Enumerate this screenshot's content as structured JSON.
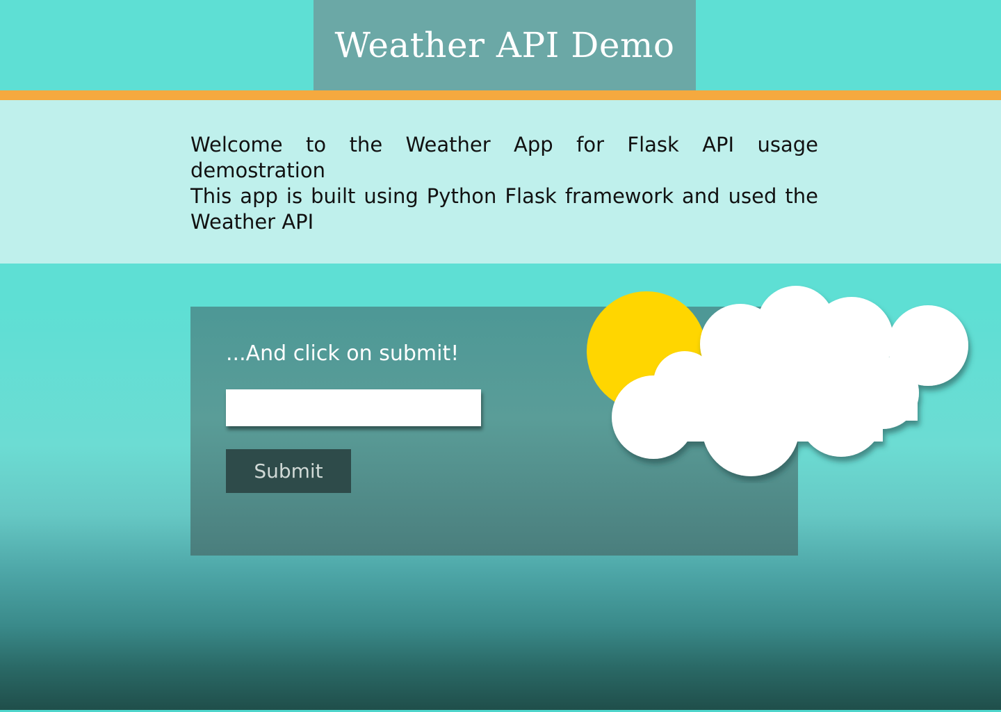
{
  "header": {
    "title": "Weather API Demo"
  },
  "intro": {
    "line1": "Welcome to the Weather App for Flask API usage demostration",
    "line2": "This app is built using Python Flask framework and used the Weather API"
  },
  "form": {
    "prompt": "...And click on submit!",
    "city_value": "",
    "submit_label": "Submit"
  },
  "colors": {
    "accent_orange": "#f5a93f",
    "header_teal": "#5edfd4",
    "title_box": "#6ba8a6",
    "intro_band": "#bff0ec",
    "card": "#4d9896",
    "button": "#2e4b4a",
    "sun": "#ffd600"
  },
  "icons": {
    "weather_art": "sun-behind-cloud-icon"
  }
}
